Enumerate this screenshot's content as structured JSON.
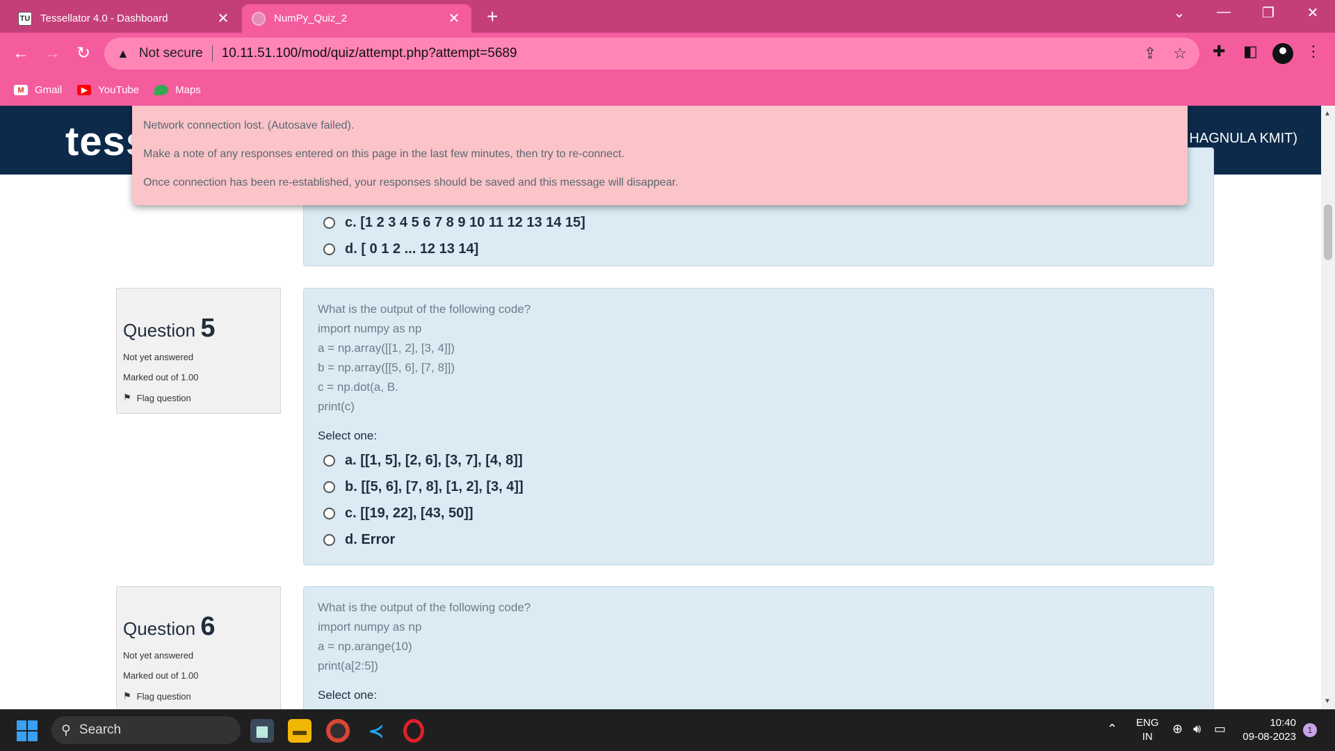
{
  "browser": {
    "tabs": [
      {
        "title": "Tessellator 4.0 - Dashboard",
        "favicon": "tu-logo-icon"
      },
      {
        "title": "NumPy_Quiz_2",
        "favicon": "globe-icon"
      }
    ],
    "address": {
      "security": "Not secure",
      "url": "10.11.51.100/mod/quiz/attempt.php?attempt=5689"
    },
    "bookmarks": [
      {
        "label": "Gmail",
        "icon": "gmail-icon"
      },
      {
        "label": "YouTube",
        "icon": "youtube-icon"
      },
      {
        "label": "Maps",
        "icon": "maps-icon"
      }
    ],
    "colors": {
      "tabstrip": "#c43f7a",
      "toolbar": "#f45c9e"
    }
  },
  "site": {
    "logo_text": "tess",
    "user_text": "HAGNULA KMIT)",
    "header_color": "#0d2a4a"
  },
  "alert": {
    "lines": [
      "Network connection lost. (Autosave failed).",
      "Make a note of any responses entered on this page in the last few minutes, then try to re-connect.",
      "Once connection has been re-established, your responses should be saved and this message will disappear."
    ]
  },
  "prev_question": {
    "options": [
      "c. [1 2 3 4 5 6 7 8 9 10 11 12 13 14 15]",
      "d. [ 0  1  2 ... 12 13 14]"
    ]
  },
  "question5": {
    "label": "Question",
    "number": "5",
    "status": "Not yet answered",
    "marks": "Marked out of 1.00",
    "flag": "Flag question",
    "text": [
      "What is the output of the following code?",
      "import numpy as np",
      "a = np.array([[1, 2], [3, 4]])",
      "b = np.array([[5, 6], [7, 8]])",
      "c = np.dot(a, B.",
      "print(c)"
    ],
    "select": "Select one:",
    "options": [
      "a. [[1, 5], [2, 6], [3, 7], [4, 8]]",
      "b. [[5, 6], [7, 8], [1, 2], [3, 4]]",
      "c. [[19, 22], [43, 50]]",
      "d. Error"
    ]
  },
  "question6": {
    "label": "Question",
    "number": "6",
    "status": "Not yet answered",
    "marks": "Marked out of 1.00",
    "flag": "Flag question",
    "text": [
      "What is the output of the following code?",
      "import numpy as np",
      "a = np.arange(10)",
      "print(a[2:5])"
    ],
    "select": "Select one:"
  },
  "taskbar": {
    "search_placeholder": "Search",
    "lang_top": "ENG",
    "lang_bottom": "IN",
    "time": "10:40",
    "date": "09-08-2023",
    "notification_count": "1"
  }
}
